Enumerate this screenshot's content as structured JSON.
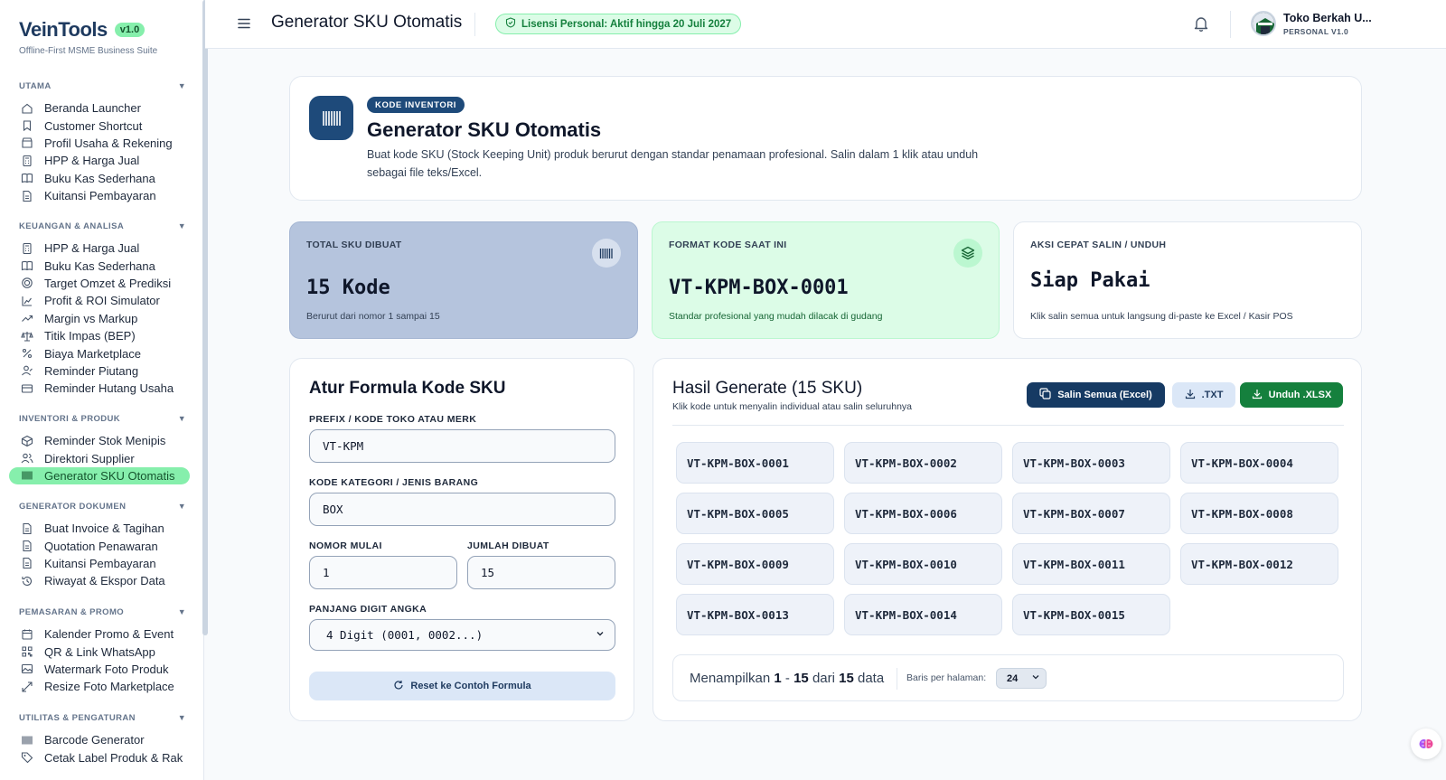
{
  "brand": {
    "name": "VeinTools",
    "version": "v1.0",
    "subtitle": "Offline-First MSME Business Suite"
  },
  "sidebar": {
    "sections": [
      {
        "title": "UTAMA",
        "items": [
          "Beranda Launcher",
          "Customer Shortcut",
          "Profil Usaha & Rekening",
          "HPP & Harga Jual",
          "Buku Kas Sederhana",
          "Kuitansi Pembayaran"
        ]
      },
      {
        "title": "KEUANGAN & ANALISA",
        "items": [
          "HPP & Harga Jual",
          "Buku Kas Sederhana",
          "Target Omzet & Prediksi",
          "Profit & ROI Simulator",
          "Margin vs Markup",
          "Titik Impas (BEP)",
          "Biaya Marketplace",
          "Reminder Piutang",
          "Reminder Hutang Usaha"
        ]
      },
      {
        "title": "INVENTORI & PRODUK",
        "items": [
          "Reminder Stok Menipis",
          "Direktori Supplier",
          "Generator SKU Otomatis"
        ]
      },
      {
        "title": "GENERATOR DOKUMEN",
        "items": [
          "Buat Invoice & Tagihan",
          "Quotation Penawaran",
          "Kuitansi Pembayaran",
          "Riwayat & Ekspor Data"
        ]
      },
      {
        "title": "PEMASARAN & PROMO",
        "items": [
          "Kalender Promo & Event",
          "QR & Link WhatsApp",
          "Watermark Foto Produk",
          "Resize Foto Marketplace"
        ]
      },
      {
        "title": "UTILITAS & PENGATURAN",
        "items": [
          "Barcode Generator",
          "Cetak Label Produk & Rak"
        ]
      }
    ]
  },
  "topbar": {
    "title": "Generator SKU Otomatis",
    "license": "Lisensi Personal: Aktif hingga 20 Juli 2027",
    "user_name": "Toko Berkah U...",
    "user_plan": "PERSONAL V1.0"
  },
  "hero": {
    "tag": "KODE INVENTORI",
    "title": "Generator SKU Otomatis",
    "description": "Buat kode SKU (Stock Keeping Unit) produk berurut dengan standar penamaan profesional. Salin dalam 1 klik atau unduh sebagai file teks/Excel."
  },
  "stats": {
    "total": {
      "label": "TOTAL SKU DIBUAT",
      "value": "15 Kode",
      "note": "Berurut dari nomor 1 sampai 15"
    },
    "format": {
      "label": "FORMAT KODE SAAT INI",
      "value": "VT-KPM-BOX-0001",
      "note": "Standar profesional yang mudah dilacak di gudang"
    },
    "action": {
      "label": "AKSI CEPAT SALIN / UNDUH",
      "value": "Siap Pakai",
      "note": "Klik salin semua untuk langsung di-paste ke Excel / Kasir POS"
    }
  },
  "form": {
    "title": "Atur Formula Kode SKU",
    "prefix_label": "PREFIX / KODE TOKO ATAU MERK",
    "prefix_value": "VT-KPM",
    "category_label": "KODE KATEGORI / JENIS BARANG",
    "category_value": "BOX",
    "start_label": "NOMOR MULAI",
    "start_value": "1",
    "count_label": "JUMLAH DIBUAT",
    "count_value": "15",
    "digits_label": "PANJANG DIGIT ANGKA",
    "digits_value": "4 Digit (0001, 0002...)",
    "reset_label": "Reset ke Contoh Formula"
  },
  "results": {
    "title": "Hasil Generate (15 SKU)",
    "subtitle": "Klik kode untuk menyalin individual atau salin seluruhnya",
    "copy_all_label": "Salin Semua (Excel)",
    "txt_label": ".TXT",
    "xlsx_label": "Unduh .XLSX",
    "skus": [
      "VT-KPM-BOX-0001",
      "VT-KPM-BOX-0002",
      "VT-KPM-BOX-0003",
      "VT-KPM-BOX-0004",
      "VT-KPM-BOX-0005",
      "VT-KPM-BOX-0006",
      "VT-KPM-BOX-0007",
      "VT-KPM-BOX-0008",
      "VT-KPM-BOX-0009",
      "VT-KPM-BOX-0010",
      "VT-KPM-BOX-0011",
      "VT-KPM-BOX-0012",
      "VT-KPM-BOX-0013",
      "VT-KPM-BOX-0014",
      "VT-KPM-BOX-0015"
    ],
    "pager": {
      "prefix": "Menampilkan",
      "from": "1",
      "sep": "-",
      "to": "15",
      "mid": "dari",
      "total": "15",
      "suffix": "data",
      "rows_label": "Baris per halaman:",
      "rows_value": "24"
    }
  },
  "colors": {
    "accent_navy": "#1e4a7a",
    "accent_green": "#86efac",
    "download_green": "#15803d"
  }
}
